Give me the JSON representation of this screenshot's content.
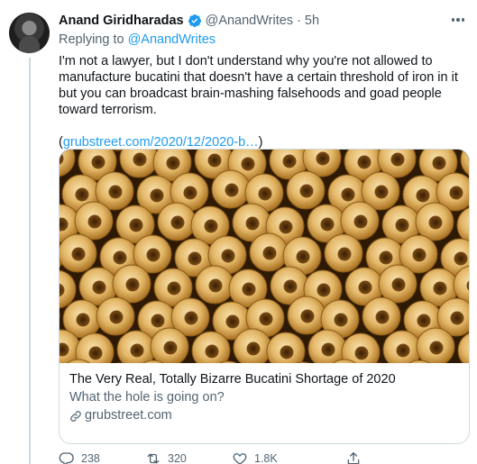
{
  "tweet": {
    "author_name": "Anand Giridharadas",
    "author_handle": "@AnandWrites",
    "separator": "·",
    "time": "5h",
    "replying_prefix": "Replying to ",
    "replying_to": "@AnandWrites",
    "text": "I'm not a lawyer, but I don't understand why you're not allowed to manufacture bucatini that doesn't have a certain threshold of iron in it but you can broadcast brain-mashing falsehoods and goad people toward terrorism.",
    "link_open": "(",
    "link_text": "grubstreet.com/2020/12/2020-b…",
    "link_close": ")"
  },
  "card": {
    "title": "The Very Real, Totally Bizarre Bucatini Shortage of 2020",
    "description": "What the hole is going on?",
    "domain": "grubstreet.com"
  },
  "actions": {
    "replies": "238",
    "retweets": "320",
    "likes": "1.8K"
  },
  "icons": {
    "verified": "verified-badge-icon",
    "more": "more-dots-icon",
    "reply": "reply-icon",
    "retweet": "retweet-icon",
    "like": "heart-icon",
    "share": "share-icon",
    "link": "link-icon"
  },
  "colors": {
    "accent": "#1d9bf0",
    "secondary_text": "#536471",
    "primary_text": "#0f1419",
    "border": "#cfd9de"
  }
}
